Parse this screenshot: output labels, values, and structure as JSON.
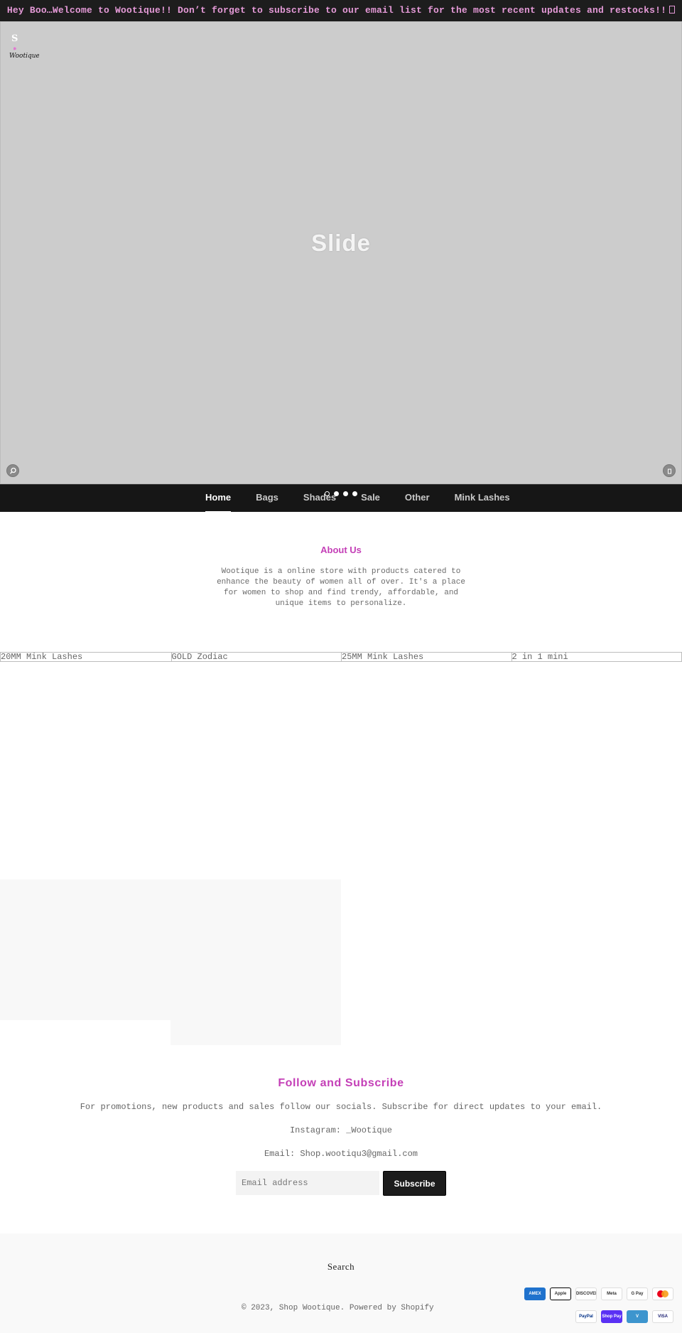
{
  "announcement": {
    "text": "Hey Boo…Welcome to Wootique!! Don’t forget to subscribe to our email list for the most recent updates and restocks!!",
    "trailing_glyph": "emoji-box-icon",
    "color": "#e59ad8"
  },
  "hero": {
    "logo_initial": "S",
    "logo_text": "Wootique",
    "slide_label": "Slide",
    "background": "#cccccc",
    "search_icon": "search-icon",
    "cart_icon": "cart-icon",
    "slides_count": 4,
    "active_slide": 2
  },
  "nav": {
    "items": [
      "Home",
      "Bags",
      "Shades",
      "Sale",
      "Other",
      "Mink Lashes"
    ],
    "active": "Home"
  },
  "about": {
    "title": "About Us",
    "text": "Wootique is a online store with products catered to enhance the beauty of women all of over. It's a place for women to shop and find trendy, affordable, and unique items to personalize."
  },
  "products": [
    "20MM Mink Lashes",
    "GOLD Zodiac",
    "25MM Mink Lashes",
    "2 in 1 mini"
  ],
  "follow": {
    "title": "Follow and Subscribe",
    "line1": "For promotions, new products and sales follow our socials. Subscribe for direct updates to your email.",
    "instagram": "Instagram: _Wootique",
    "email": "Email: Shop.wootiqu3@gmail.com",
    "email_placeholder": "Email address",
    "subscribe_label": "Subscribe",
    "accent": "#c43fb7"
  },
  "footer": {
    "search_label": "Search",
    "copyright": "© 2023, Shop Wootique. Powered by Shopify",
    "payments_row1": [
      "AMEX",
      "Apple Pay",
      "DISCOVER",
      "Meta",
      "G Pay",
      "Mastercard"
    ],
    "payments_row2": [
      "PayPal",
      "Shop Pay",
      "V",
      "VISA"
    ]
  }
}
